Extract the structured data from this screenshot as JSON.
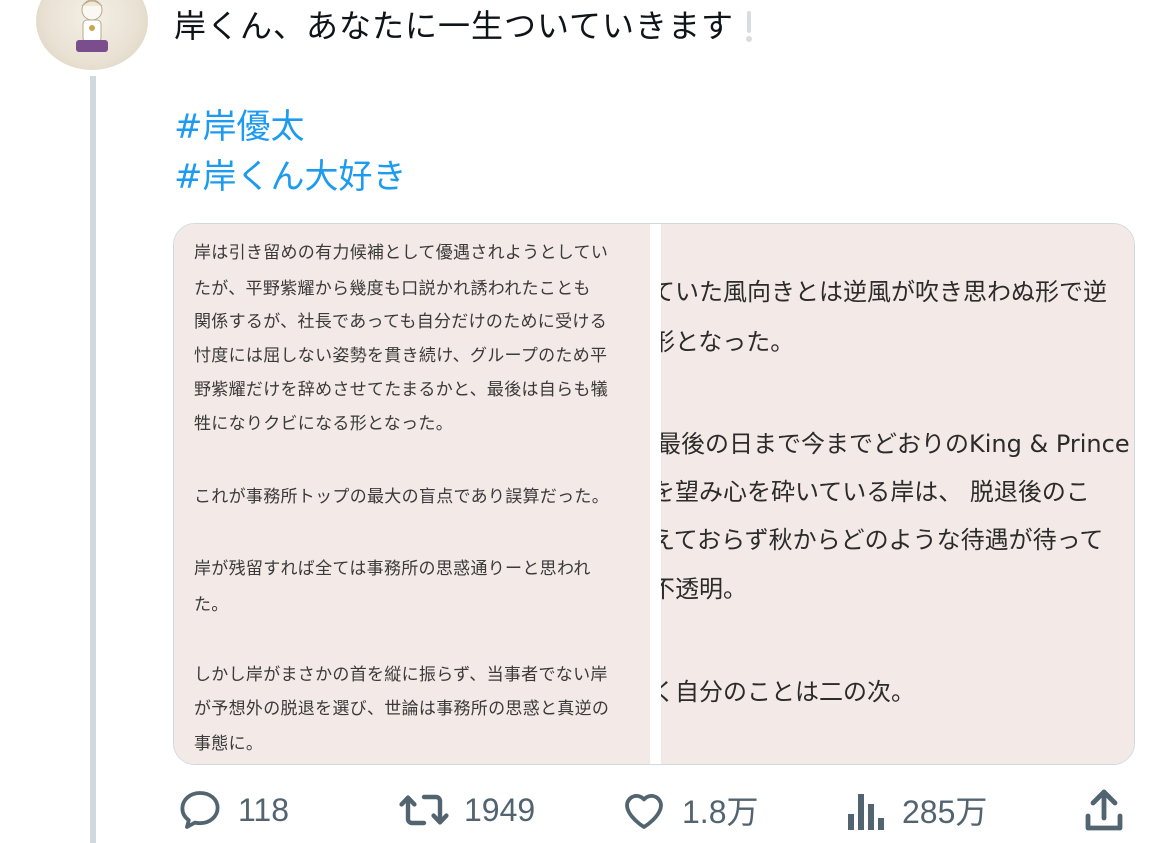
{
  "tweet": {
    "text": "岸くん、あなたに一生ついていきます",
    "hashtags": [
      "#岸優太",
      "#岸くん大好き"
    ]
  },
  "media": {
    "left_lines": [
      "岸は引き留めの有力候補として優遇されようとしてい",
      "たが、平野紫耀から幾度も口説かれ誘われたことも",
      "関係するが、社長であっても自分だけのために受ける",
      "忖度には屈しない姿勢を貫き続け、グループのため平",
      "野紫耀だけを辞めさせてたまるかと、最後は自らも犠",
      "牲になりクビになる形となった。",
      "これが事務所トップの最大の盲点であり誤算だった。",
      "岸が残留すれば全ては事務所の思惑通りーと思われ",
      "た。",
      "しかし岸がまさかの首を縦に振らず、当事者でない岸",
      "が予想外の脱退を選び、世論は事務所の思惑と真逆の",
      "事態に。"
    ],
    "right_lines": [
      "ていた風向きとは逆風が吹き思わぬ形で逆",
      "形となった。",
      "最後の日まで今までどおりのKing & Prince",
      "を望み心を砕いている岸は、 脱退後のこ",
      "えておらず秋からどのような待遇が待って",
      "不透明。",
      "く自分のことは二の次。"
    ]
  },
  "actions": {
    "reply": "118",
    "retweet": "1949",
    "like": "1.8万",
    "views": "285万"
  },
  "icons": [
    "reply-icon",
    "retweet-icon",
    "like-icon",
    "views-icon",
    "share-icon"
  ],
  "colors": {
    "hashtag": "#1d9bf0",
    "icon": "#536471",
    "thread": "#cfd9de"
  }
}
